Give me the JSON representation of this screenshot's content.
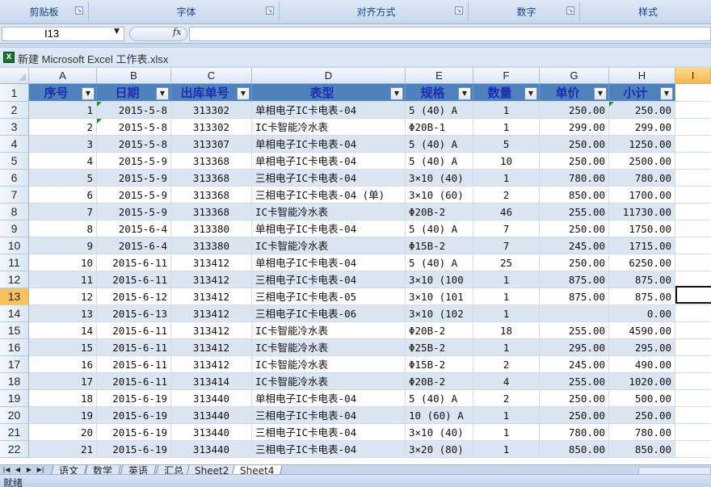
{
  "ribbon": {
    "groups": [
      {
        "label": "剪贴板"
      },
      {
        "label": "字体"
      },
      {
        "label": "对齐方式"
      },
      {
        "label": "数字"
      },
      {
        "label": "样式"
      }
    ]
  },
  "formula_bar": {
    "name_box": "I13",
    "fx": "fx",
    "formula": ""
  },
  "workbook": {
    "title": "新建 Microsoft Excel 工作表.xlsx"
  },
  "columns": [
    "A",
    "B",
    "C",
    "D",
    "E",
    "F",
    "G",
    "H",
    "I"
  ],
  "row_numbers": [
    "1",
    "2",
    "3",
    "4",
    "5",
    "6",
    "7",
    "8",
    "9",
    "10",
    "11",
    "12",
    "13",
    "14",
    "15",
    "16",
    "17",
    "18",
    "19",
    "20",
    "21",
    "22"
  ],
  "table": {
    "headers": [
      "序号",
      "日期",
      "出库单号",
      "表型",
      "规格",
      "数量",
      "单价",
      "小计"
    ],
    "rows": [
      [
        "1",
        "2015-5-8",
        "313302",
        "单相电子IC卡电表-04",
        "5 (40) A",
        "1",
        "250.00",
        "250.00"
      ],
      [
        "2",
        "2015-5-8",
        "313302",
        "IC卡智能冷水表",
        "Φ20B-1",
        "1",
        "299.00",
        "299.00"
      ],
      [
        "3",
        "2015-5-8",
        "313307",
        "单相电子IC卡电表-04",
        "5 (40) A",
        "5",
        "250.00",
        "1250.00"
      ],
      [
        "4",
        "2015-5-9",
        "313368",
        "单相电子IC卡电表-04",
        "5 (40) A",
        "10",
        "250.00",
        "2500.00"
      ],
      [
        "5",
        "2015-5-9",
        "313368",
        "三相电子IC卡电表-04",
        "3×10 (40)",
        "1",
        "780.00",
        "780.00"
      ],
      [
        "6",
        "2015-5-9",
        "313368",
        "三相电子IC卡电表-04 (单)",
        "3×10 (60)",
        "2",
        "850.00",
        "1700.00"
      ],
      [
        "7",
        "2015-5-9",
        "313368",
        "IC卡智能冷水表",
        "Φ20B-2",
        "46",
        "255.00",
        "11730.00"
      ],
      [
        "8",
        "2015-6-4",
        "313380",
        "单相电子IC卡电表-04",
        "5 (40) A",
        "7",
        "250.00",
        "1750.00"
      ],
      [
        "9",
        "2015-6-4",
        "313380",
        "IC卡智能冷水表",
        "Φ15B-2",
        "7",
        "245.00",
        "1715.00"
      ],
      [
        "10",
        "2015-6-11",
        "313412",
        "单相电子IC卡电表-04",
        "5 (40) A",
        "25",
        "250.00",
        "6250.00"
      ],
      [
        "11",
        "2015-6-11",
        "313412",
        "三相电子IC卡电表-04",
        "3×10 (100",
        "1",
        "875.00",
        "875.00"
      ],
      [
        "12",
        "2015-6-12",
        "313412",
        "三相电子IC卡电表-05",
        "3×10 (101",
        "1",
        "875.00",
        "875.00"
      ],
      [
        "13",
        "2015-6-13",
        "313412",
        "三相电子IC卡电表-06",
        "3×10 (102",
        "1",
        "",
        "0.00"
      ],
      [
        "14",
        "2015-6-11",
        "313412",
        "IC卡智能冷水表",
        "Φ20B-2",
        "18",
        "255.00",
        "4590.00"
      ],
      [
        "15",
        "2015-6-11",
        "313412",
        "IC卡智能冷水表",
        "Φ25B-2",
        "1",
        "295.00",
        "295.00"
      ],
      [
        "16",
        "2015-6-11",
        "313412",
        "IC卡智能冷水表",
        "Φ15B-2",
        "2",
        "245.00",
        "490.00"
      ],
      [
        "17",
        "2015-6-11",
        "313414",
        "IC卡智能冷水表",
        "Φ20B-2",
        "4",
        "255.00",
        "1020.00"
      ],
      [
        "18",
        "2015-6-19",
        "313440",
        "单相电子IC卡电表-04",
        "5 (40) A",
        "2",
        "250.00",
        "500.00"
      ],
      [
        "19",
        "2015-6-19",
        "313440",
        "三相电子IC卡电表-04",
        "10 (60) A",
        "1",
        "250.00",
        "250.00"
      ],
      [
        "20",
        "2015-6-19",
        "313440",
        "三相电子IC卡电表-04",
        "3×10 (40)",
        "1",
        "780.00",
        "780.00"
      ],
      [
        "21",
        "2015-6-19",
        "313440",
        "三相电子IC卡电表-04",
        "3×20 (80)",
        "1",
        "850.00",
        "850.00"
      ]
    ]
  },
  "sheet_tabs": [
    "语文",
    "数学",
    "英语",
    "汇总",
    "Sheet2",
    "Sheet4"
  ],
  "active_tab": "Sheet4",
  "status": {
    "text": "就绪"
  },
  "colors": {
    "header_fill": "#4f81bd",
    "band_fill": "#dbe5f1",
    "header_text": "#1a2fb0",
    "selected_header": "#f6b94b"
  }
}
